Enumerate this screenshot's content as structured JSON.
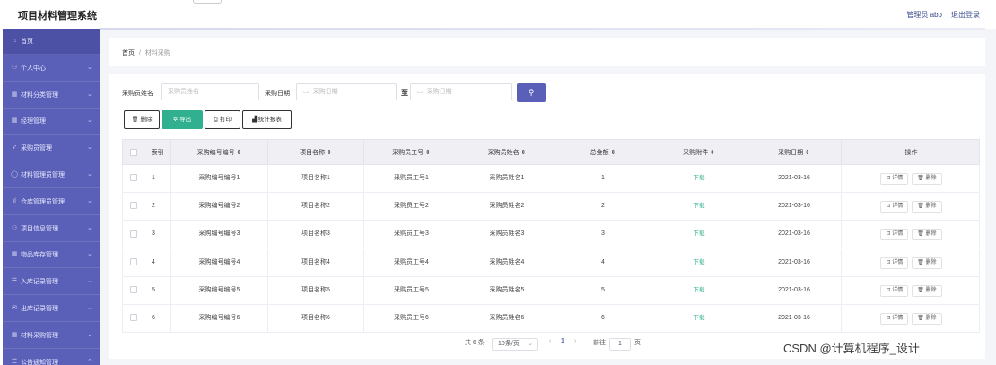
{
  "app": {
    "title": "项目材料管理系统",
    "user": "管理员 abo",
    "logout": "退出登录"
  },
  "sidebar": {
    "items": [
      {
        "label": "首页",
        "icon": "home-icon",
        "glyph": "⌂"
      },
      {
        "label": "个人中心",
        "icon": "user-icon",
        "glyph": "⚇"
      },
      {
        "label": "材料分类管理",
        "icon": "grid-icon",
        "glyph": "▦"
      },
      {
        "label": "经理管理",
        "icon": "grid-icon",
        "glyph": "▦"
      },
      {
        "label": "采购员管理",
        "icon": "send-icon",
        "glyph": "➶"
      },
      {
        "label": "材料管理员管理",
        "icon": "circle-icon",
        "glyph": "◯"
      },
      {
        "label": "仓库管理员管理",
        "icon": "bar-chart-icon",
        "glyph": "ıl"
      },
      {
        "label": "项目信息管理",
        "icon": "users-icon",
        "glyph": "⚇"
      },
      {
        "label": "物品库存管理",
        "icon": "box-icon",
        "glyph": "▦"
      },
      {
        "label": "入库记录管理",
        "icon": "list-icon",
        "glyph": "☰"
      },
      {
        "label": "出库记录管理",
        "icon": "mail-icon",
        "glyph": "✉"
      },
      {
        "label": "材料采购管理",
        "icon": "grid-icon",
        "glyph": "▦"
      },
      {
        "label": "公告通知管理",
        "icon": "list-icon",
        "glyph": "☰"
      }
    ]
  },
  "breadcrumb": {
    "home": "首页",
    "sep": "/",
    "current": "材料采购"
  },
  "search": {
    "name_label": "采购员姓名",
    "name_placeholder": "采购员姓名",
    "date_label": "采购日期",
    "date_from_placeholder": "采购日期",
    "to_label": "至",
    "date_to_placeholder": "采购日期",
    "button_icon": "search-icon"
  },
  "toolbar": {
    "delete": "删除",
    "export": "导出",
    "print": "打印",
    "stats": "统计报表"
  },
  "table": {
    "headers": [
      "索引",
      "采购编号编号 ⇕",
      "项目名称 ⇕",
      "采购员工号 ⇕",
      "采购员姓名 ⇕",
      "总金额 ⇕",
      "采购附件 ⇕",
      "采购日期 ⇕",
      "操作"
    ],
    "rows": [
      {
        "index": "1",
        "code": "采购编号编号1",
        "project": "项目名称1",
        "staff_no": "采购员工号1",
        "staff_name": "采购员姓名1",
        "amount": "1",
        "attachment": "下载",
        "date": "2021-03-16"
      },
      {
        "index": "2",
        "code": "采购编号编号2",
        "project": "项目名称2",
        "staff_no": "采购员工号2",
        "staff_name": "采购员姓名2",
        "amount": "2",
        "attachment": "下载",
        "date": "2021-03-16"
      },
      {
        "index": "3",
        "code": "采购编号编号3",
        "project": "项目名称3",
        "staff_no": "采购员工号3",
        "staff_name": "采购员姓名3",
        "amount": "3",
        "attachment": "下载",
        "date": "2021-03-16"
      },
      {
        "index": "4",
        "code": "采购编号编号4",
        "project": "项目名称4",
        "staff_no": "采购员工号4",
        "staff_name": "采购员姓名4",
        "amount": "4",
        "attachment": "下载",
        "date": "2021-03-16"
      },
      {
        "index": "5",
        "code": "采购编号编号5",
        "project": "项目名称5",
        "staff_no": "采购员工号5",
        "staff_name": "采购员姓名5",
        "amount": "5",
        "attachment": "下载",
        "date": "2021-03-16"
      },
      {
        "index": "6",
        "code": "采购编号编号6",
        "project": "项目名称6",
        "staff_no": "采购员工号6",
        "staff_name": "采购员姓名6",
        "amount": "6",
        "attachment": "下载",
        "date": "2021-03-16"
      }
    ],
    "action_detail": "详情",
    "action_delete": "删除"
  },
  "pagination": {
    "total": "共 6 条",
    "page_size": "10条/页",
    "prev": "‹",
    "current": "1",
    "next": "›",
    "goto_label": "前往",
    "goto_value": "1",
    "page_unit": "页"
  },
  "watermark": "CSDN @计算机程序_设计",
  "colors": {
    "sidebar": "#5a5fb7",
    "primary": "#5a5fb7",
    "success": "#30b08f"
  }
}
